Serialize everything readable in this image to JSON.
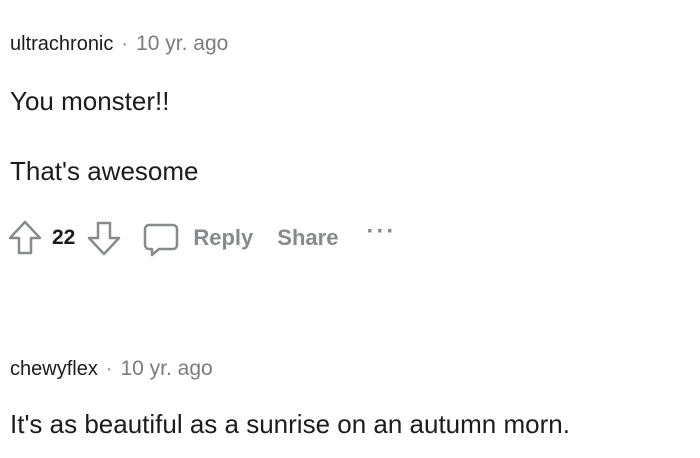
{
  "comments": [
    {
      "author": "ultrachronic",
      "separator": "·",
      "time": "10 yr. ago",
      "lines": [
        "You monster!!",
        "That's awesome"
      ],
      "votes": "22",
      "actions": {
        "reply": "Reply",
        "share": "Share",
        "more": "···"
      }
    },
    {
      "author": "chewyflex",
      "separator": "·",
      "time": "10 yr. ago",
      "lines": [
        "It's as beautiful as a sunrise on an autumn morn."
      ]
    }
  ],
  "icons": {
    "upvote": "upvote-icon",
    "downvote": "downvote-icon",
    "comment": "comment-bubble-icon"
  },
  "colors": {
    "text": "#1c1c1c",
    "muted": "#878a8c",
    "background": "#ffffff"
  }
}
